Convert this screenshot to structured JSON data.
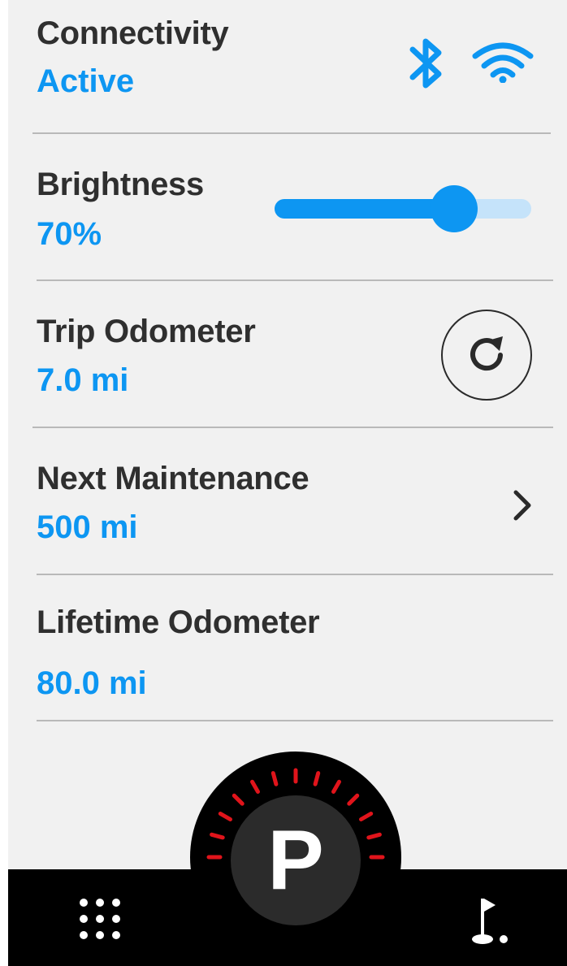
{
  "colors": {
    "accent": "#0d96f2",
    "title_text": "#2f2f2f",
    "background": "#f1f1f1",
    "divider": "#b9b9b9",
    "tick": "#e0141b",
    "bar": "#000000"
  },
  "connectivity": {
    "title": "Connectivity",
    "value": "Active",
    "icons": [
      "bluetooth-icon",
      "wifi-icon"
    ]
  },
  "brightness": {
    "title": "Brightness",
    "value": "70%",
    "level": 0.7
  },
  "trip_odometer": {
    "title": "Trip Odometer",
    "value": "7.0 mi",
    "action_icon": "reset-icon"
  },
  "next_maintenance": {
    "title": "Next Maintenance",
    "value": "500 mi",
    "action_icon": "chevron-right-icon"
  },
  "lifetime_odometer": {
    "title": "Lifetime Odometer",
    "value": "80.0 mi"
  },
  "gear": {
    "letter": "P"
  },
  "bottom_bar": {
    "left_icon": "apps-grid-icon",
    "right_icon": "golf-flag-icon"
  }
}
